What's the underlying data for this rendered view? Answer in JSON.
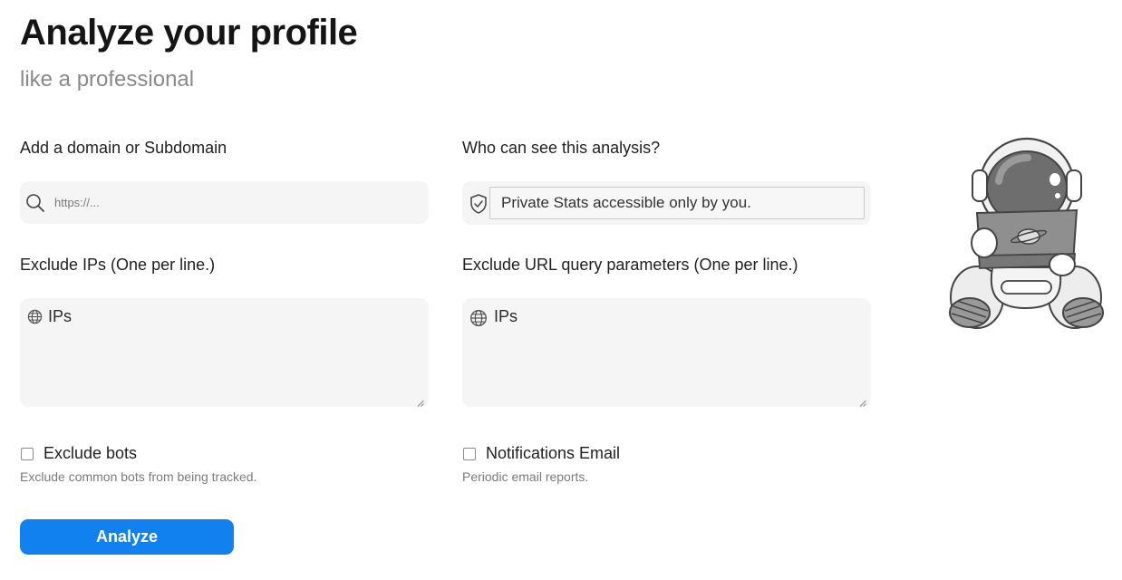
{
  "header": {
    "title": "Analyze your profile",
    "subtitle": "like a professional"
  },
  "domain": {
    "label": "Add a domain or Subdomain",
    "placeholder": "https://...",
    "icon": "search-icon"
  },
  "visibility": {
    "label": "Who can see this analysis?",
    "selected": "Private Stats accessible only by you.",
    "icon": "shield-check-icon"
  },
  "exclude_ips": {
    "label": "Exclude IPs (One per line.)",
    "placeholder": "IPs",
    "icon": "globe-icon"
  },
  "exclude_params": {
    "label": "Exclude URL query parameters (One per line.)",
    "placeholder": "IPs",
    "icon": "globe-icon"
  },
  "exclude_bots": {
    "label": "Exclude bots",
    "hint": "Exclude common bots from being tracked.",
    "checked": false
  },
  "notifications": {
    "label": "Notifications Email",
    "hint": "Periodic email reports.",
    "checked": false
  },
  "actions": {
    "analyze_label": "Analyze"
  },
  "colors": {
    "accent": "#1181f0",
    "field_bg": "#f5f5f5"
  }
}
